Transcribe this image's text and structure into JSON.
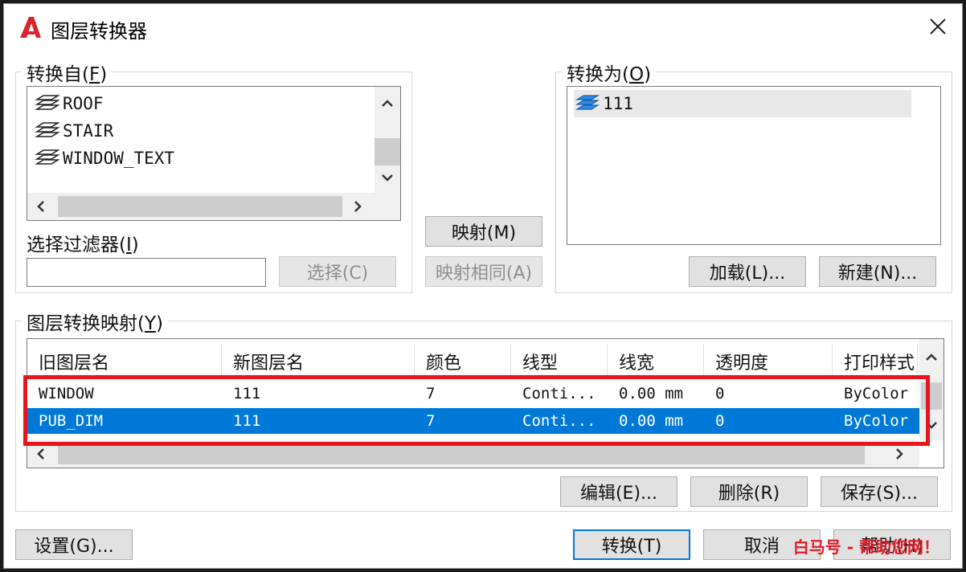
{
  "window": {
    "title": "图层转换器",
    "app_icon": "autocad-logo-icon",
    "close_icon": "close-icon"
  },
  "convert_from": {
    "label": "转换自(",
    "label_key": "F",
    "label_end": ")",
    "items": [
      "ROOF",
      "STAIR",
      "WINDOW_TEXT"
    ]
  },
  "convert_to": {
    "label": "转换为(",
    "label_key": "O",
    "label_end": ")",
    "items": [
      "111"
    ]
  },
  "filter": {
    "label": "选择过滤器(",
    "label_key": "I",
    "label_end": ")",
    "value": "",
    "select_button": "选择(C)"
  },
  "middle": {
    "map_button": "映射(M)",
    "map_same_button": "映射相同(A)"
  },
  "convert_to_buttons": {
    "load_button": "加载(L)...",
    "new_button": "新建(N)..."
  },
  "mapping": {
    "label": "图层转换映射(",
    "label_key": "Y",
    "label_end": ")",
    "columns": [
      "旧图层名",
      "新图层名",
      "颜色",
      "线型",
      "线宽",
      "透明度",
      "打印样式"
    ],
    "rows": [
      {
        "old": "WINDOW",
        "new": "111",
        "color": "7",
        "linetype": "Conti...",
        "lineweight": "0.00 mm",
        "transparency": "0",
        "plotstyle": "ByColor"
      },
      {
        "old": "PUB_DIM",
        "new": "111",
        "color": "7",
        "linetype": "Conti...",
        "lineweight": "0.00 mm",
        "transparency": "0",
        "plotstyle": "ByColor"
      }
    ],
    "edit_button": "编辑(E)...",
    "delete_button": "删除(R)",
    "save_button": "保存(S)..."
  },
  "footer": {
    "settings_button": "设置(G)...",
    "convert_button": "转换(T)",
    "cancel_button": "取消",
    "help_button": "帮助(H)"
  },
  "watermark": "白马号 - 帮助您网！",
  "colors": {
    "accent": "#0078d7",
    "highlight": "#e8141c",
    "logo": "#d9252f"
  }
}
